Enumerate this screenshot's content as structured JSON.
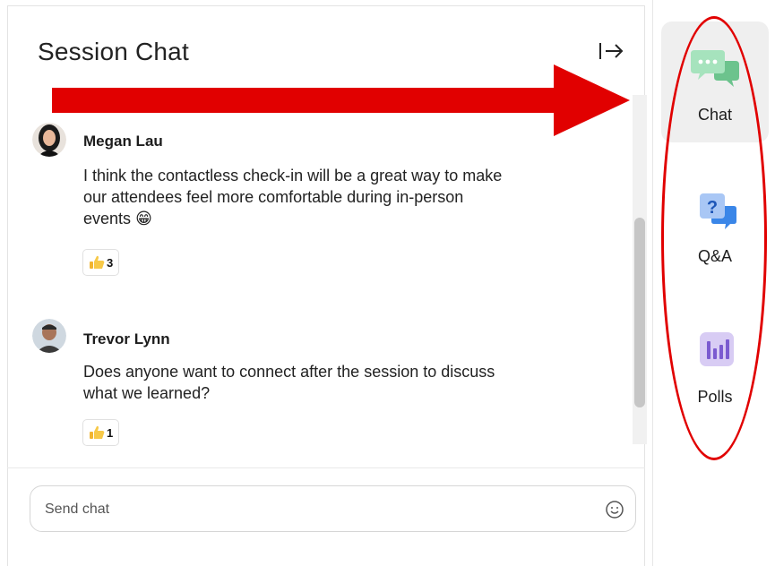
{
  "panel": {
    "title": "Session Chat",
    "collapse_icon": "arrow-right-to-bar-icon"
  },
  "messages": [
    {
      "author": "Megan Lau",
      "text_lines": [
        "I think the contactless check-in will be a great way to make",
        "our attendees feel more comfortable during in-person",
        "events"
      ],
      "trailing_emoji": "😁",
      "reaction": {
        "icon": "thumbs-up-icon",
        "count": "3"
      }
    },
    {
      "author": "Trevor Lynn",
      "text_lines": [
        "Does anyone want to connect after the session to discuss",
        "what we learned?"
      ],
      "reaction": {
        "icon": "thumbs-up-icon",
        "count": "1"
      }
    }
  ],
  "composer": {
    "placeholder": "Send chat",
    "emoji_icon": "smiley-face-icon"
  },
  "sidebar": {
    "items": [
      {
        "label": "Chat",
        "icon": "chat-bubbles-icon",
        "active": true
      },
      {
        "label": "Q&A",
        "icon": "question-bubble-icon",
        "active": false
      },
      {
        "label": "Polls",
        "icon": "bar-chart-icon",
        "active": false
      }
    ]
  },
  "colors": {
    "chat_icon_green": "#7ccf9b",
    "qa_icon_blue": "#3a86e8",
    "polls_icon_purple": "#8b6fd6",
    "annotation_red": "#e10000",
    "active_tab_bg": "#efefef"
  }
}
